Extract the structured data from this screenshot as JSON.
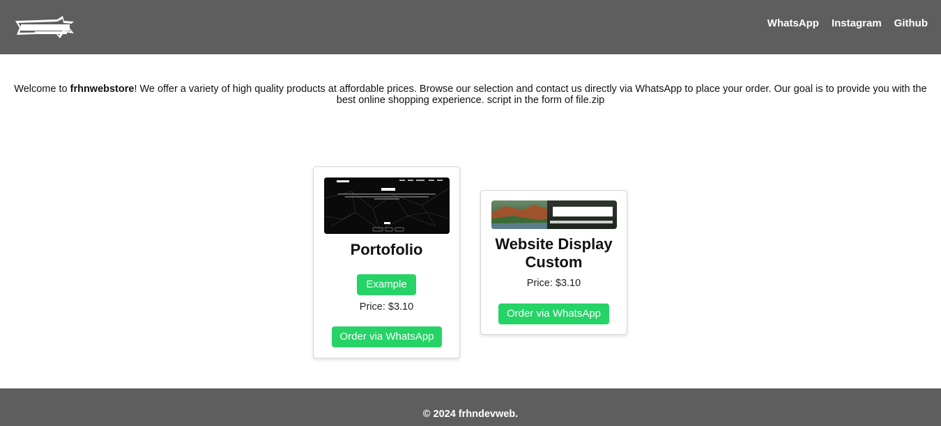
{
  "header": {
    "logo_alt": "frhndevweb",
    "nav": [
      "WhatsApp",
      "Instagram",
      "Github"
    ]
  },
  "intro": {
    "prefix": "Welcome to ",
    "store_name": "frhnwebstore",
    "suffix": "! We offer a variety of high quality products at affordable prices. Browse our selection and contact us directly via WhatsApp to place your order. Our goal is to provide you with the best online shopping experience. script in the form of file.zip"
  },
  "products": [
    {
      "title": "Portofolio",
      "example_label": "Example",
      "price": "Price: $3.10",
      "order_label": "Order via WhatsApp"
    },
    {
      "title": "Website Display Custom",
      "price": "Price: $3.10",
      "order_label": "Order via WhatsApp"
    }
  ],
  "footer": {
    "text": "© 2024 frhndevweb."
  },
  "colors": {
    "header_bg": "#5e5e5e",
    "button_green": "#25d366"
  }
}
